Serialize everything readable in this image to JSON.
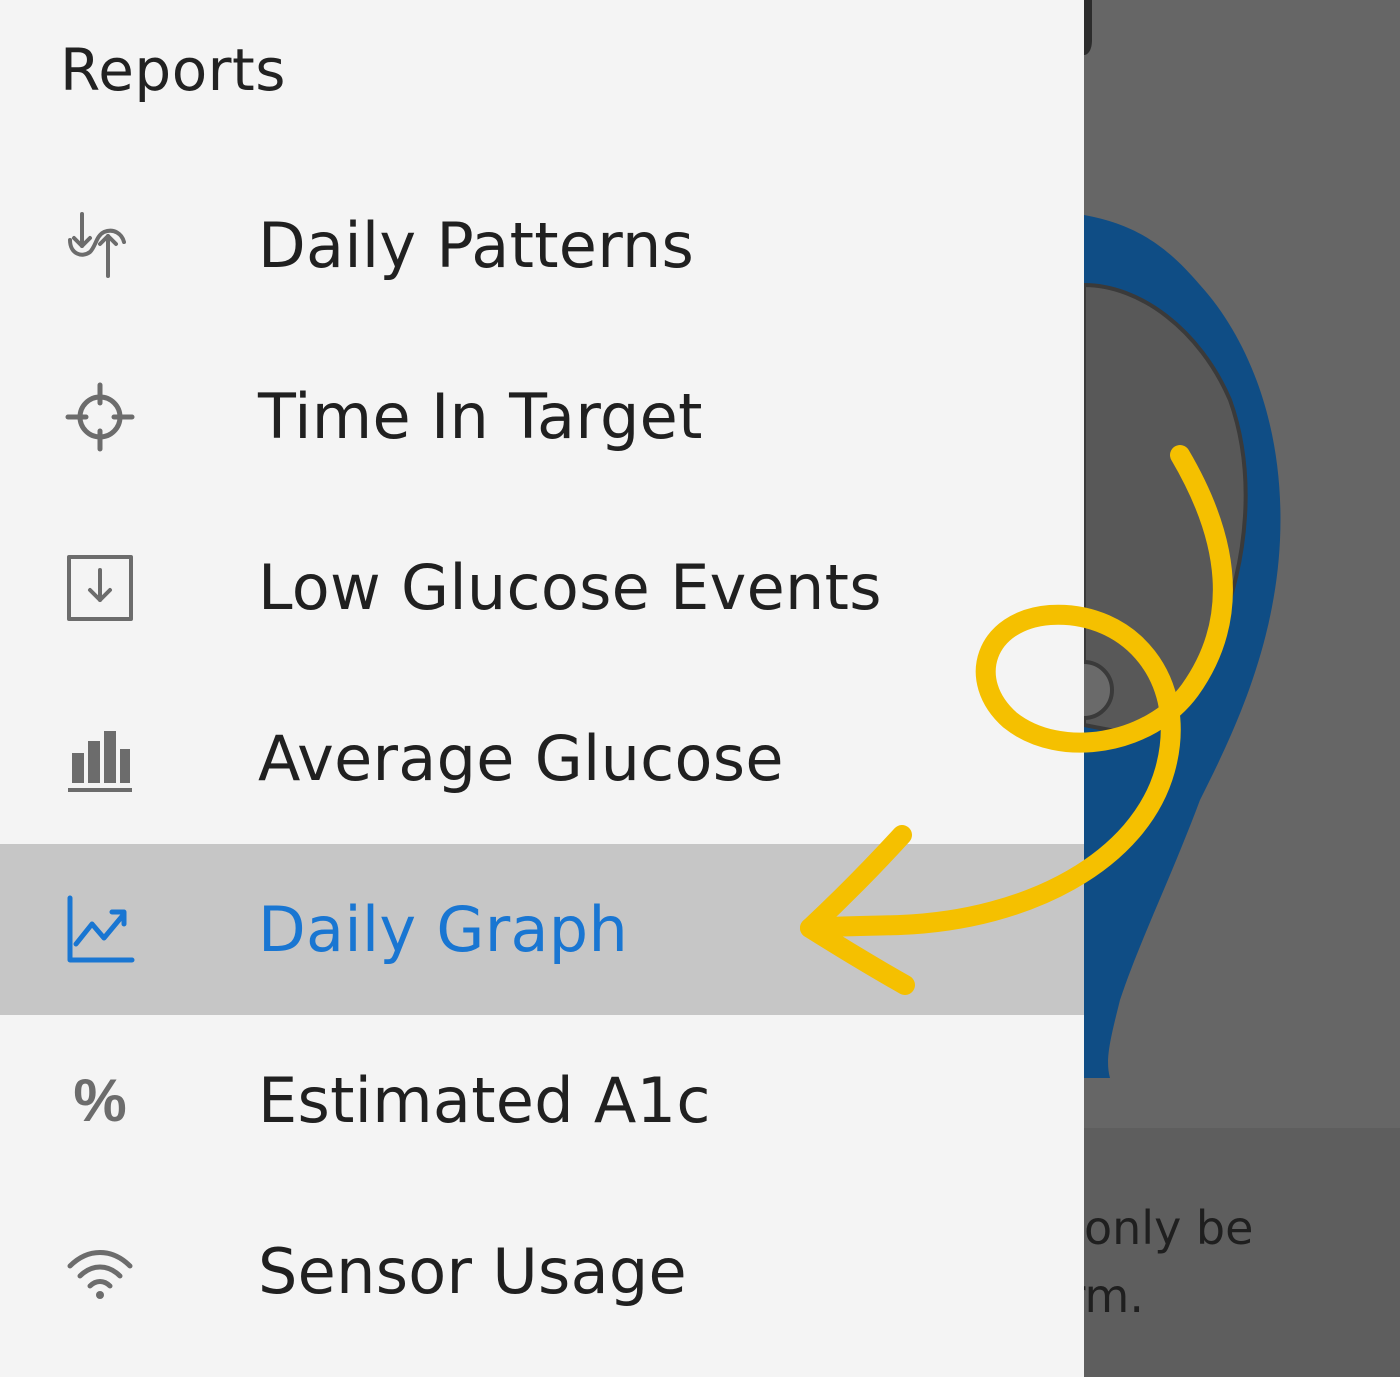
{
  "drawer": {
    "title": "Reports",
    "items": [
      {
        "label": "Daily Patterns",
        "icon": "daily-patterns-icon",
        "active": false
      },
      {
        "label": "Time In Target",
        "icon": "crosshair-target-icon",
        "active": false
      },
      {
        "label": "Low Glucose Events",
        "icon": "download-box-icon",
        "active": false
      },
      {
        "label": "Average Glucose",
        "icon": "bar-chart-icon",
        "active": false
      },
      {
        "label": "Daily Graph",
        "icon": "line-graph-icon",
        "active": true
      },
      {
        "label": "Estimated A1c",
        "icon": "percent-icon",
        "active": false,
        "glyph": "%"
      },
      {
        "label": "Sensor Usage",
        "icon": "wifi-signal-icon",
        "active": false
      }
    ]
  },
  "background": {
    "text_line_1": "only be",
    "text_line_2": "rm."
  },
  "colors": {
    "drawer_background": "#f4f4f4",
    "active_item_background": "#c6c6c6",
    "active_item_text": "#1976d2",
    "scrim": "#666666",
    "sensor_blue": "#0f4d85",
    "annotation_yellow": "#f5c000",
    "icon_gray": "#6c6c6c"
  }
}
